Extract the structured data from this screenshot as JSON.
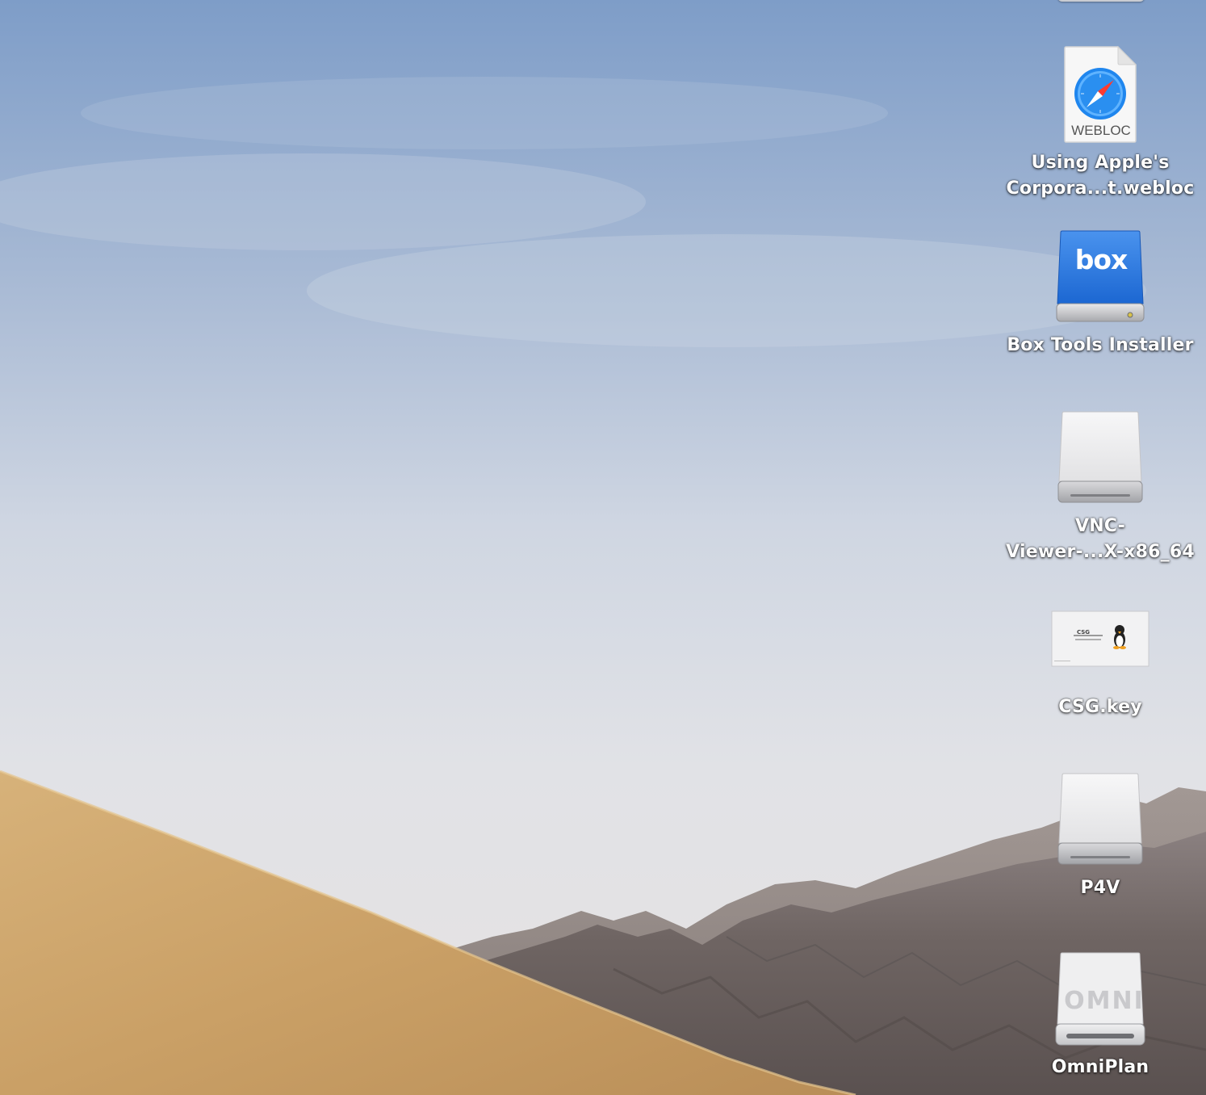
{
  "desktop": {
    "icons": [
      {
        "id": "webloc",
        "label_lines": [
          "Using Apple's",
          "Corpora...t.webloc"
        ],
        "badge_text": "WEBLOC",
        "icon": "safari-compass-icon"
      },
      {
        "id": "box",
        "label_lines": [
          "Box Tools Installer"
        ],
        "logo_text": "box",
        "icon": "box-drive-icon",
        "accent": "#2f7be0"
      },
      {
        "id": "vnc",
        "label_lines": [
          "VNC-",
          "Viewer-...X-x86_64"
        ],
        "icon": "external-drive-icon"
      },
      {
        "id": "csg",
        "label_lines": [
          "CSG.key"
        ],
        "slide_title": "CSG",
        "icon": "keynote-thumbnail-icon"
      },
      {
        "id": "p4v",
        "label_lines": [
          "P4V"
        ],
        "icon": "external-drive-icon"
      },
      {
        "id": "omniplan",
        "label_lines": [
          "OmniPlan"
        ],
        "logo_text": "OMNI",
        "icon": "omni-drive-icon"
      }
    ]
  },
  "colors": {
    "sky_top": "#7f9ec8",
    "sky_bottom": "#e4e3e3",
    "sand": "#d0a86a",
    "mountain": "#6c6360",
    "label": "#ffffff"
  }
}
